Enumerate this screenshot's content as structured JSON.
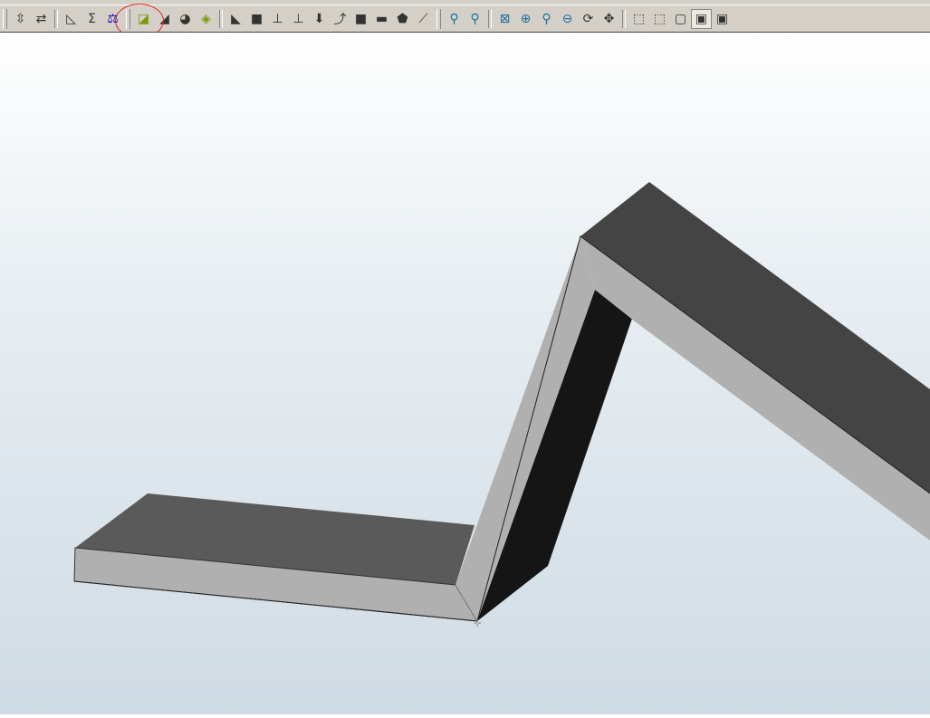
{
  "toolbar": {
    "buttons": [
      {
        "name": "arrange-icon",
        "glyph": "⇳"
      },
      {
        "name": "swap-icon",
        "glyph": "⇄"
      },
      {
        "name": "measure-icon",
        "glyph": "◺"
      },
      {
        "name": "sum-icon",
        "glyph": "Σ"
      },
      {
        "name": "balance-icon",
        "glyph": "⚖"
      },
      {
        "name": "base-flange-icon",
        "glyph": "◪"
      },
      {
        "name": "edge-flange-icon",
        "glyph": "◢"
      },
      {
        "name": "miter-flange-icon",
        "glyph": "◕"
      },
      {
        "name": "hem-icon",
        "glyph": "◈"
      },
      {
        "name": "sketched-bend-icon",
        "glyph": "◣"
      },
      {
        "name": "flat-icon",
        "glyph": "■"
      },
      {
        "name": "unfold-icon",
        "glyph": "⊥"
      },
      {
        "name": "fold-icon",
        "glyph": "⊥"
      },
      {
        "name": "jog-icon",
        "glyph": "⬇"
      },
      {
        "name": "corner-icon",
        "glyph": "⤴"
      },
      {
        "name": "rip-icon",
        "glyph": "■"
      },
      {
        "name": "tab-icon",
        "glyph": "▬"
      },
      {
        "name": "lofted-bend-icon",
        "glyph": "⬟"
      },
      {
        "name": "cross-break-icon",
        "glyph": "⟋"
      },
      {
        "name": "light-icon",
        "glyph": "⚲"
      },
      {
        "name": "add-light-icon",
        "glyph": "⚲"
      },
      {
        "name": "zoom-fit-icon",
        "glyph": "⊠"
      },
      {
        "name": "zoom-in-icon",
        "glyph": "⊕"
      },
      {
        "name": "zoom-area-icon",
        "glyph": "⚲"
      },
      {
        "name": "zoom-out-icon",
        "glyph": "⊖"
      },
      {
        "name": "rotate-icon",
        "glyph": "⟳"
      },
      {
        "name": "pan-icon",
        "glyph": "✥"
      },
      {
        "name": "wireframe-icon",
        "glyph": "⬚"
      },
      {
        "name": "hidden-lines-visible-icon",
        "glyph": "⬚"
      },
      {
        "name": "hidden-lines-removed-icon",
        "glyph": "▢"
      },
      {
        "name": "shaded-icon",
        "glyph": "▣",
        "active": true
      },
      {
        "name": "shaded-edges-icon",
        "glyph": "▣"
      }
    ]
  },
  "colors": {
    "annotation_circle": "#dd2222",
    "part_top": "#5a5a5a",
    "part_edge": "#b0b0b0",
    "part_shadow": "#151515"
  }
}
